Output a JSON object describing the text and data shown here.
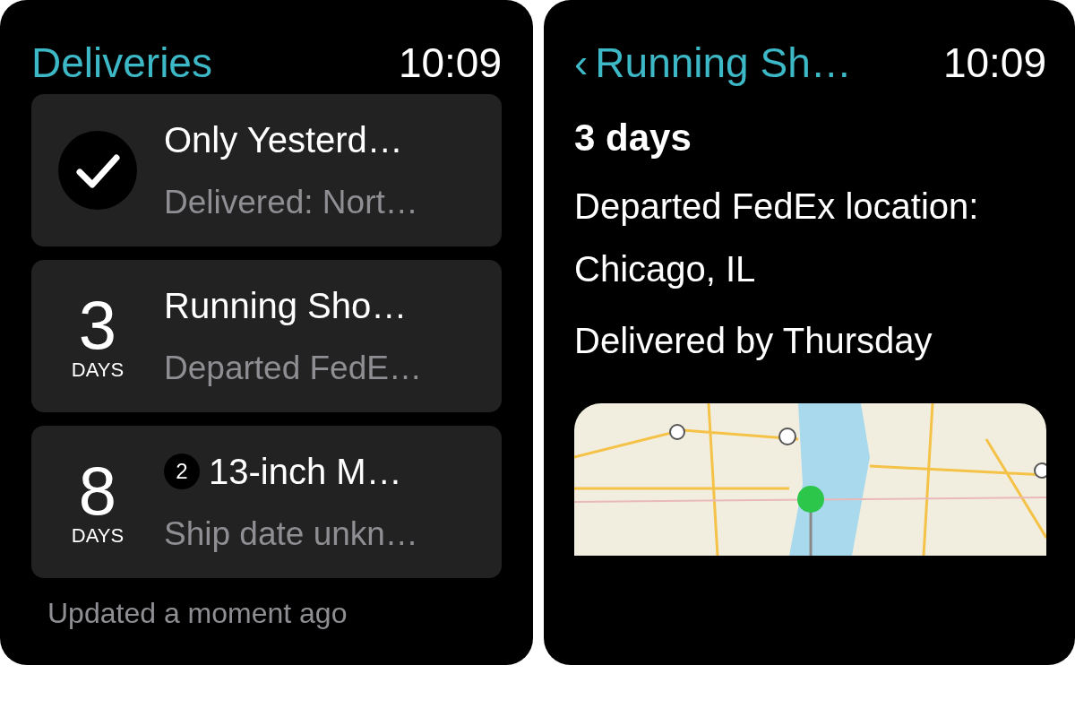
{
  "screens": [
    {
      "kind": "list",
      "title": "Deliveries",
      "time": "10:09",
      "deliveries": [
        {
          "kind": "delivered",
          "name": "Only Yesterd…",
          "status": "Delivered: Nort…"
        },
        {
          "kind": "countdown",
          "count": "3",
          "unit": "DAYS",
          "name": "Running Sho…",
          "status": "Departed FedE…"
        },
        {
          "kind": "countdown",
          "count": "8",
          "unit": "DAYS",
          "badge": "2",
          "name": "13-inch M…",
          "status": "Ship date unkn…"
        }
      ],
      "footer": "Updated a moment ago"
    },
    {
      "kind": "detail",
      "back": "‹",
      "title": "Running Sh…",
      "time": "10:09",
      "eta": "3 days",
      "event": "Departed FedEx location: Chicago, IL",
      "estimate": "Delivered by Thursday"
    }
  ]
}
